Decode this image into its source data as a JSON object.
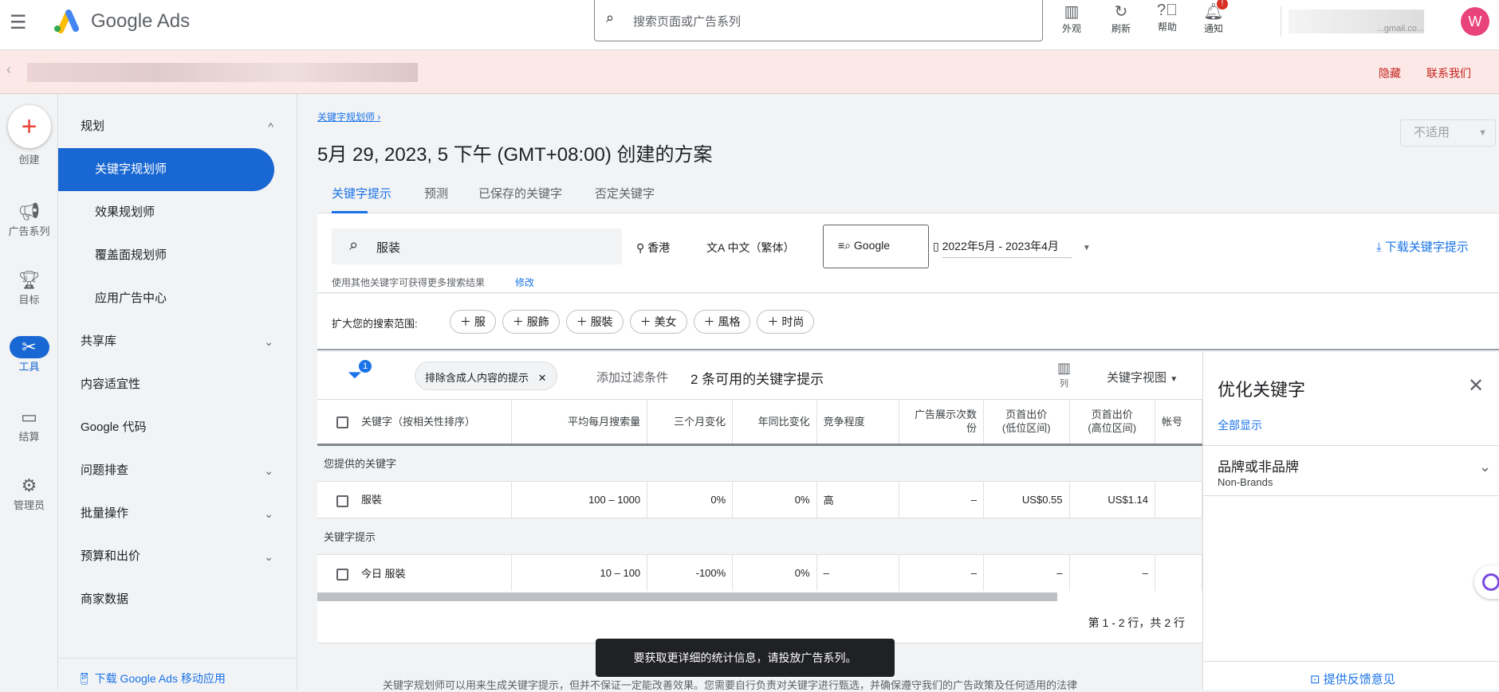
{
  "header": {
    "brand": "Google Ads",
    "search_placeholder": "搜索页面或广告系列",
    "actions": [
      {
        "icon": "appearance-icon",
        "label": "外观"
      },
      {
        "icon": "refresh-icon",
        "label": "刷新"
      },
      {
        "icon": "help-icon",
        "label": "帮助"
      },
      {
        "icon": "bell-icon",
        "label": "通知"
      }
    ],
    "notification_badge": "!",
    "account_email": "...gmail.co...",
    "avatar_letter": "W"
  },
  "banner": {
    "hide": "隐藏",
    "contact": "联系我们"
  },
  "rail": [
    {
      "icon": "plus-icon",
      "label": "创建"
    },
    {
      "icon": "megaphone-icon",
      "label": "广告系列"
    },
    {
      "icon": "trophy-icon",
      "label": "目标"
    },
    {
      "icon": "tools-icon",
      "label": "工具"
    },
    {
      "icon": "billing-icon",
      "label": "结算"
    },
    {
      "icon": "gear-icon",
      "label": "管理员"
    }
  ],
  "nav": {
    "items": [
      {
        "label": "规划",
        "chevron": "^"
      },
      {
        "label": "关键字规划师"
      },
      {
        "label": "效果规划师"
      },
      {
        "label": "覆盖面规划师"
      },
      {
        "label": "应用广告中心"
      },
      {
        "label": "共享库",
        "chevron": "⌄"
      },
      {
        "label": "内容适宜性"
      },
      {
        "label": "Google 代码"
      },
      {
        "label": "问题排查",
        "chevron": "⌄"
      },
      {
        "label": "批量操作",
        "chevron": "⌄"
      },
      {
        "label": "预算和出价",
        "chevron": "⌄"
      },
      {
        "label": "商家数据"
      }
    ],
    "download_app": "下载 Google Ads 移动应用"
  },
  "page": {
    "breadcrumb": "关键字规划师",
    "title": "5月 29, 2023, 5 下午 (GMT+08:00) 创建的方案",
    "not_applicable": "不适用",
    "tabs": [
      "关键字提示",
      "预测",
      "已保存的关键字",
      "否定关键字"
    ],
    "search_value": "服装",
    "location": "香港",
    "language": "中文（繁体）",
    "network": "Google",
    "date_range": "2022年5月 - 2023年4月",
    "download": "下载关键字提示",
    "hint": "使用其他关键字可获得更多搜索结果",
    "hint_link": "修改",
    "broaden_label": "扩大您的搜索范围:",
    "broaden_chips": [
      "服",
      "服飾",
      "服裝",
      "美女",
      "風格",
      "时尚"
    ],
    "filter_badge": "1",
    "filter_chip": "排除含成人内容的提示",
    "add_filter": "添加过滤条件",
    "available": "2 条可用的关键字提示",
    "columns_label": "列",
    "view_label": "关键字视图"
  },
  "table": {
    "headers": [
      "关键字（按相关性排序）",
      "平均每月搜索量",
      "三个月变化",
      "年同比变化",
      "竞争程度",
      "广告展示次数份",
      "页首出价\n(低位区间)",
      "页首出价\n(高位区间)",
      "帐号"
    ],
    "groups": [
      {
        "title": "您提供的关键字",
        "rows": [
          [
            "服裝",
            "100 – 1000",
            "0%",
            "0%",
            "高",
            "–",
            "US$0.55",
            "US$1.14",
            ""
          ]
        ]
      },
      {
        "title": "关键字提示",
        "rows": [
          [
            "今日 服裝",
            "10 – 100",
            "-100%",
            "0%",
            "–",
            "–",
            "–",
            "–",
            ""
          ]
        ]
      }
    ],
    "pagination": "第 1 - 2 行，共 2 行"
  },
  "toast": "要获取更详细的统计信息，请投放广告系列。",
  "footer": "关键字规划师可以用来生成关键字提示，但并不保证一定能改善效果。您需要自行负责对关键字进行甄选，并确保遵守我们的广告政策及任何适用的法律",
  "panel": {
    "title": "优化关键字",
    "show_all": "全部显示",
    "section_title": "品牌或非品牌",
    "section_value": "Non-Brands",
    "feedback": "提供反馈意见"
  }
}
